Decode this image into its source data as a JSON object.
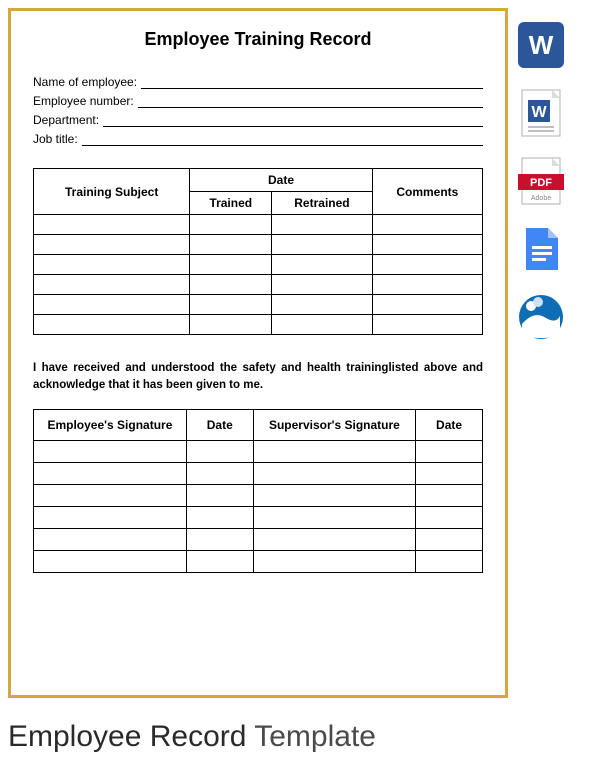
{
  "title": "Employee Training Record",
  "fields": {
    "name": "Name of employee:",
    "number": "Employee number:",
    "department": "Department:",
    "jobtitle": "Job title:"
  },
  "training_table": {
    "subject_header": "Training Subject",
    "date_header": "Date",
    "trained_header": "Trained",
    "retrained_header": "Retrained",
    "comments_header": "Comments",
    "row_count": 6
  },
  "ack_text": "I have received and understood the safety and health traininglisted above and acknowledge that it has been given to me.",
  "sig_table": {
    "emp_sig": "Employee's Signature",
    "date1": "Date",
    "sup_sig": "Supervisor's Signature",
    "date2": "Date",
    "row_count": 6
  },
  "caption_bold": "Employee Record",
  "caption_rest": " Template",
  "icons": {
    "word": "word-icon",
    "wordalt": "word-alt-icon",
    "pdf": "pdf-icon",
    "gdoc": "google-doc-icon",
    "ooo": "openoffice-icon"
  }
}
